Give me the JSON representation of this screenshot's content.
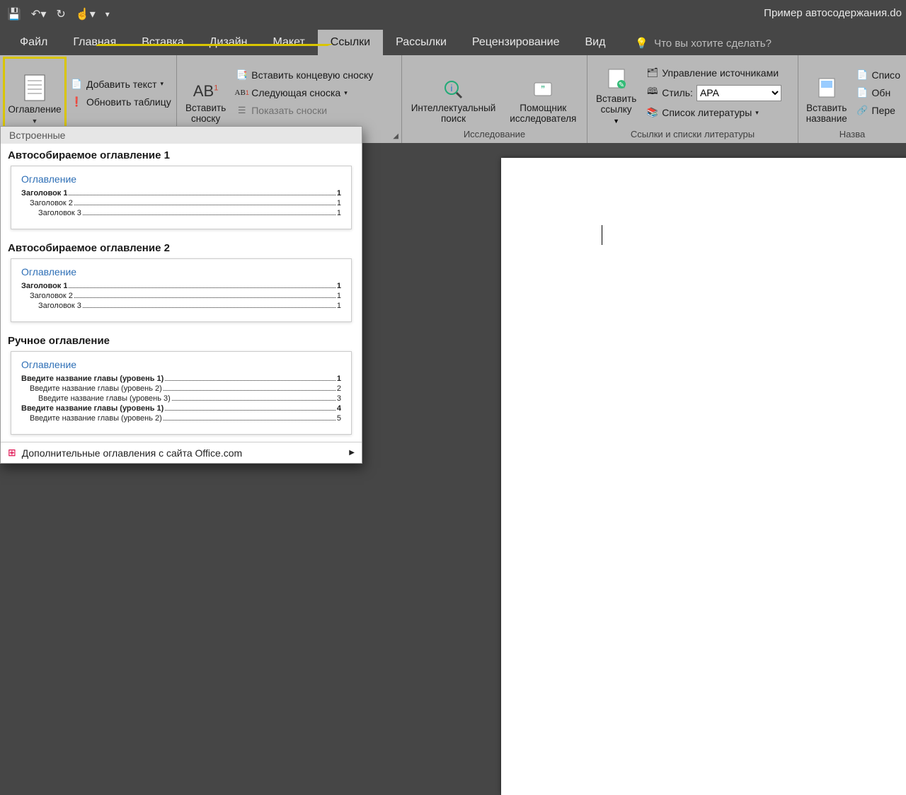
{
  "document_title": "Пример автосодержания.do",
  "qat": {
    "save": "save-icon",
    "undo": "undo-icon",
    "redo": "redo-icon",
    "touch": "touch-icon"
  },
  "tabs": [
    "Файл",
    "Главная",
    "Вставка",
    "Дизайн",
    "Макет",
    "Ссылки",
    "Рассылки",
    "Рецензирование",
    "Вид"
  ],
  "active_tab_index": 5,
  "tell_me_placeholder": "Что вы хотите сделать?",
  "ribbon": {
    "toc": {
      "button": "Оглавление",
      "add_text": "Добавить текст",
      "update": "Обновить таблицу"
    },
    "footnotes": {
      "insert": "Вставить\nсноску",
      "ab": "AB",
      "end": "Вставить концевую сноску",
      "next": "Следующая сноска",
      "show": "Показать сноски",
      "group": ""
    },
    "research": {
      "smart": "Интеллектуальный\nпоиск",
      "helper": "Помощник\nисследователя",
      "group": "Исследование"
    },
    "citations": {
      "insert": "Вставить\nссылку",
      "manage": "Управление источниками",
      "style_label": "Стиль:",
      "style_value": "APA",
      "biblio": "Список литературы",
      "group": "Ссылки и списки литературы"
    },
    "captions": {
      "insert": "Вставить\nназвание",
      "list": "Списо",
      "update": "Обн",
      "cross": "Пере",
      "group": "Назва"
    }
  },
  "gallery": {
    "head": "Встроенные",
    "items": [
      {
        "title": "Автособираемое оглавление 1",
        "heading": "Оглавление",
        "rows": [
          {
            "t": "Заголовок 1",
            "p": "1",
            "lvl": 1
          },
          {
            "t": "Заголовок 2",
            "p": "1",
            "lvl": 2
          },
          {
            "t": "Заголовок 3",
            "p": "1",
            "lvl": 3
          }
        ]
      },
      {
        "title": "Автособираемое оглавление 2",
        "heading": "Оглавление",
        "rows": [
          {
            "t": "Заголовок 1",
            "p": "1",
            "lvl": 1
          },
          {
            "t": "Заголовок 2",
            "p": "1",
            "lvl": 2
          },
          {
            "t": "Заголовок 3",
            "p": "1",
            "lvl": 3
          }
        ]
      },
      {
        "title": "Ручное оглавление",
        "heading": "Оглавление",
        "rows": [
          {
            "t": "Введите название главы (уровень 1)",
            "p": "1",
            "lvl": 1
          },
          {
            "t": "Введите название главы (уровень 2)",
            "p": "2",
            "lvl": 2
          },
          {
            "t": "Введите название главы (уровень 3)",
            "p": "3",
            "lvl": 3
          },
          {
            "t": "Введите название главы (уровень 1)",
            "p": "4",
            "lvl": 1
          },
          {
            "t": "Введите название главы (уровень 2)",
            "p": "5",
            "lvl": 2
          }
        ]
      }
    ],
    "footer": "Дополнительные оглавления с сайта Office.com"
  }
}
